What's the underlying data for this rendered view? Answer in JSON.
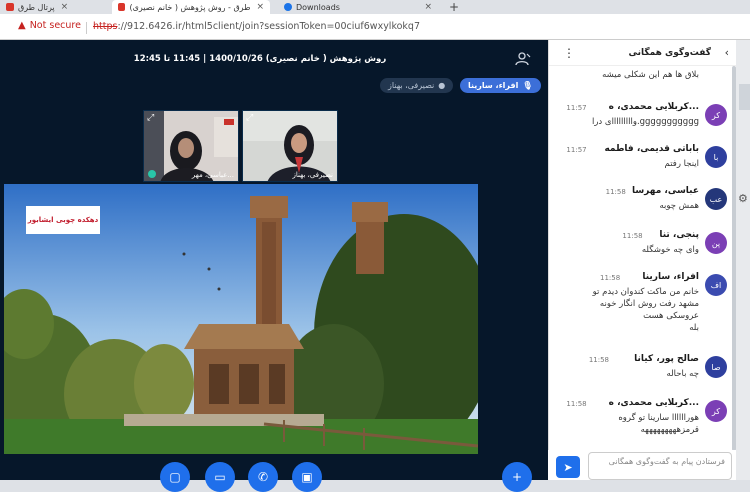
{
  "browser": {
    "tabs": [
      {
        "label": "پرتال طرق",
        "active": false
      },
      {
        "label": "طرق - روش پژوهش ( خانم نصیری)",
        "active": true
      },
      {
        "label": "Downloads",
        "active": false
      }
    ],
    "new_tab_label": "+",
    "security_text": "Not secure",
    "url_scheme": "https",
    "url_rest": "://912.6426.ir/html5client/join?sessionToken=00ciuf6wxylkokq7"
  },
  "meeting": {
    "title": "روش پژوهش ( خانم نصیری) 1400/10/26 | 11:45 تا 12:45",
    "talking": [
      {
        "label": "افراء، سارینا",
        "speaking": true
      },
      {
        "label": "نصیرفی، بهناز",
        "speaking": false
      }
    ],
    "webcams": [
      {
        "name": "عباسی، مهر..."
      },
      {
        "name": "نصیرفی، بهناز"
      }
    ],
    "screenshare_watermark": "دهکده چوبی ایشابور",
    "controls": [
      "mic-button",
      "camera-button",
      "phone-button",
      "screen-button"
    ]
  },
  "chat": {
    "title": "گفت‌وگوی همگانی",
    "messages": [
      {
        "sender": "",
        "time": "",
        "initials": "",
        "color": "#7b3fb5",
        "lines": [
          "بلاق ها هم این شکلی میشه"
        ]
      },
      {
        "sender": "کربلایی محمدی، ه...",
        "time": "11:57",
        "initials": "کر",
        "color": "#7b3fb5",
        "lines": [
          "وااااااااای درا.ggggggggggg"
        ]
      },
      {
        "sender": "باباتی قدیمی، فاطمه",
        "time": "11:57",
        "initials": "با",
        "color": "#2e3f9e",
        "lines": [
          "اینجا رفتم"
        ]
      },
      {
        "sender": "عباسی، مهرسا",
        "time": "11:58",
        "initials": "عب",
        "color": "#24377a",
        "lines": [
          "همش چوبه"
        ]
      },
      {
        "sender": "پنجی، تنا",
        "time": "11:58",
        "initials": "پن",
        "color": "#7b3fb5",
        "lines": [
          "وای چه خوشگله"
        ]
      },
      {
        "sender": "افراء، سارینا",
        "time": "11:58",
        "initials": "اف",
        "color": "#3b4bb0",
        "lines": [
          "خانم من ماکت کندوان دیدم تو",
          "مشهد رفت روش انگار خونه",
          "عروسکی هست",
          "بله"
        ]
      },
      {
        "sender": "صالح پور، کیانا",
        "time": "11:58",
        "initials": "صا",
        "color": "#2e3f9e",
        "lines": [
          "چه باحاله"
        ]
      },
      {
        "sender": "کربلایی محمدی، ه...",
        "time": "11:58",
        "initials": "کر",
        "color": "#7b3fb5",
        "lines": [
          "هوراااااا سارینا تو گروه",
          "قرمزهههههههههه"
        ]
      }
    ],
    "input_placeholder": "فرستادن پیام به گفت‌وگوی همگانی"
  }
}
